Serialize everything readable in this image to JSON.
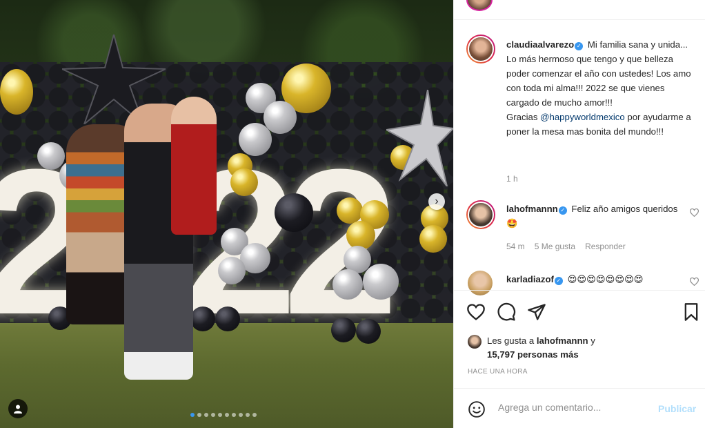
{
  "post": {
    "image": {
      "decor_number": "2022",
      "carousel_next_icon": "chevron-right-icon",
      "tagged_icon": "user-tag-icon",
      "carousel_dots_count": 10,
      "carousel_active_index": 0
    },
    "caption": {
      "username": "claudiaalvarezo",
      "text_1": "Mi familia sana y unida... Lo más hermoso que tengo y que belleza poder comenzar el año con ustedes! Los amo con toda mi alma!!! 2022 se que vienes cargado de mucho amor!!!",
      "text_2_prefix": "Gracias ",
      "mention": "@happyworldmexico",
      "text_2_suffix": " por ayudarme a poner la mesa mas bonita del mundo!!!",
      "time": "1 h"
    },
    "comments": [
      {
        "username": "lahofmannn",
        "text": "Feliz año amigos queridos 🤩",
        "time": "54 m",
        "likes": "5 Me gusta",
        "reply": "Responder"
      },
      {
        "username": "karladiazof",
        "text": "😍😍😍😍😍😍😍😍"
      }
    ],
    "likes": {
      "prefix": "Les gusta a ",
      "user": "lahofmannn",
      "middle": " y",
      "count": "15,797 personas más"
    },
    "posted_time": "HACE UNA HORA",
    "comment_box": {
      "placeholder": "Agrega un comentario...",
      "publish": "Publicar"
    }
  },
  "colors": {
    "verified": "#3897f0",
    "mention": "#00376b",
    "muted": "#8e8e8e",
    "publish_disabled": "#b2dffc"
  }
}
